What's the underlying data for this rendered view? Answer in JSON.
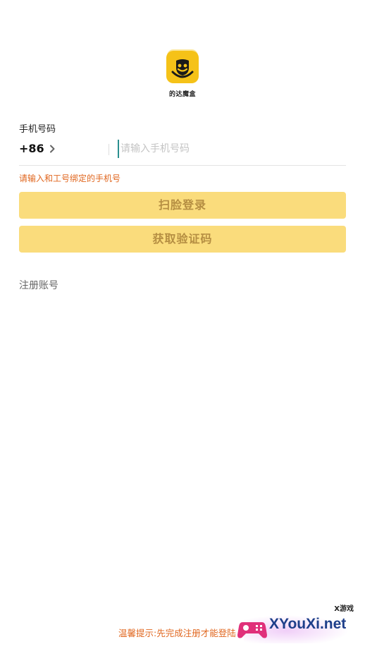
{
  "app": {
    "name": "的达魔盒"
  },
  "form": {
    "phone_label": "手机号码",
    "country_code": "+86",
    "phone_placeholder": "请输入手机号码",
    "phone_value": "",
    "hint": "请输入和工号绑定的手机号"
  },
  "buttons": {
    "face_login": "扫脸登录",
    "get_code": "获取验证码"
  },
  "links": {
    "register": "注册账号"
  },
  "footer": {
    "notice": "温馨提示:先完成注册才能登陆"
  },
  "watermark": {
    "text": "XYouXi.net",
    "tag": "X游戏"
  },
  "colors": {
    "brand": "#f5c218",
    "button_bg": "#fadc7c",
    "button_text": "#b58e42",
    "hint": "#e0661e"
  },
  "icons": {
    "logo": "smiling-face-logo",
    "chevron": "chevron-right-icon"
  }
}
